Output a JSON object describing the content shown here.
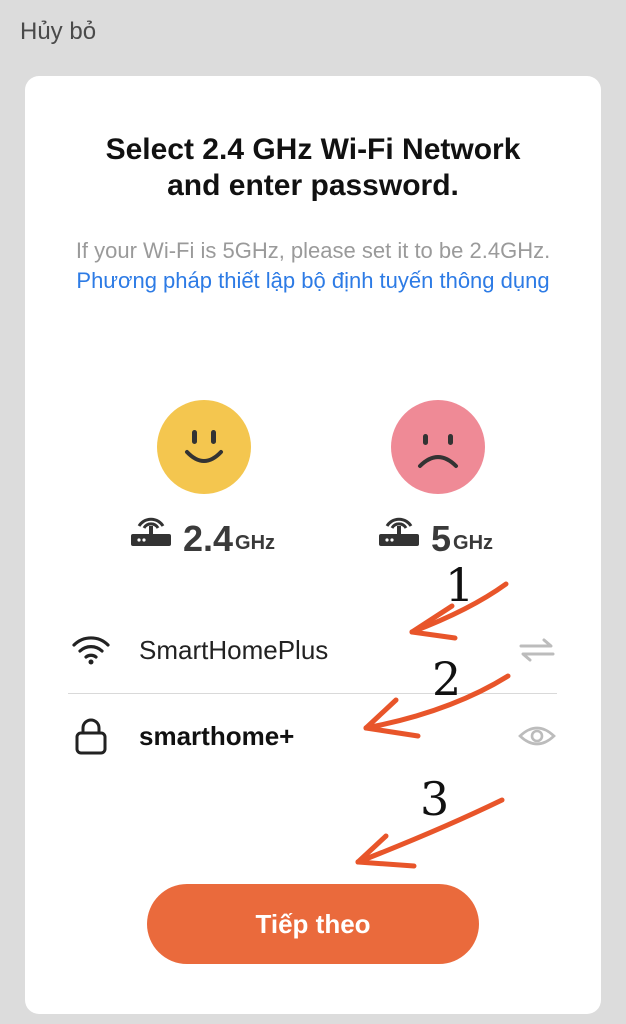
{
  "header": {
    "cancel_label": "Hủy bỏ"
  },
  "card": {
    "title_line1": "Select 2.4 GHz Wi-Fi Network",
    "title_line2": "and enter password.",
    "description": "If your Wi-Fi is 5GHz, please set it to be 2.4GHz.",
    "description_link": "Phương pháp thiết lập bộ định tuyến thông dụng"
  },
  "bands": [
    {
      "value": "2.4",
      "unit": "GHz",
      "face": "happy-face-icon",
      "color": "#f4c64f"
    },
    {
      "value": "5",
      "unit": "GHz",
      "face": "sad-face-icon",
      "color": "#ef8a96"
    }
  ],
  "wifi": {
    "ssid": "SmartHomePlus",
    "icon": "wifi-icon",
    "switch_icon": "swap-arrows-icon"
  },
  "password": {
    "value": "smarthome+",
    "icon": "lock-icon",
    "toggle_icon": "eye-icon"
  },
  "next_button": {
    "label": "Tiếp theo",
    "color": "#ea6a3c"
  },
  "annotations": {
    "step1": "1",
    "step2": "2",
    "step3": "3",
    "arrow_color": "#e8552a"
  }
}
